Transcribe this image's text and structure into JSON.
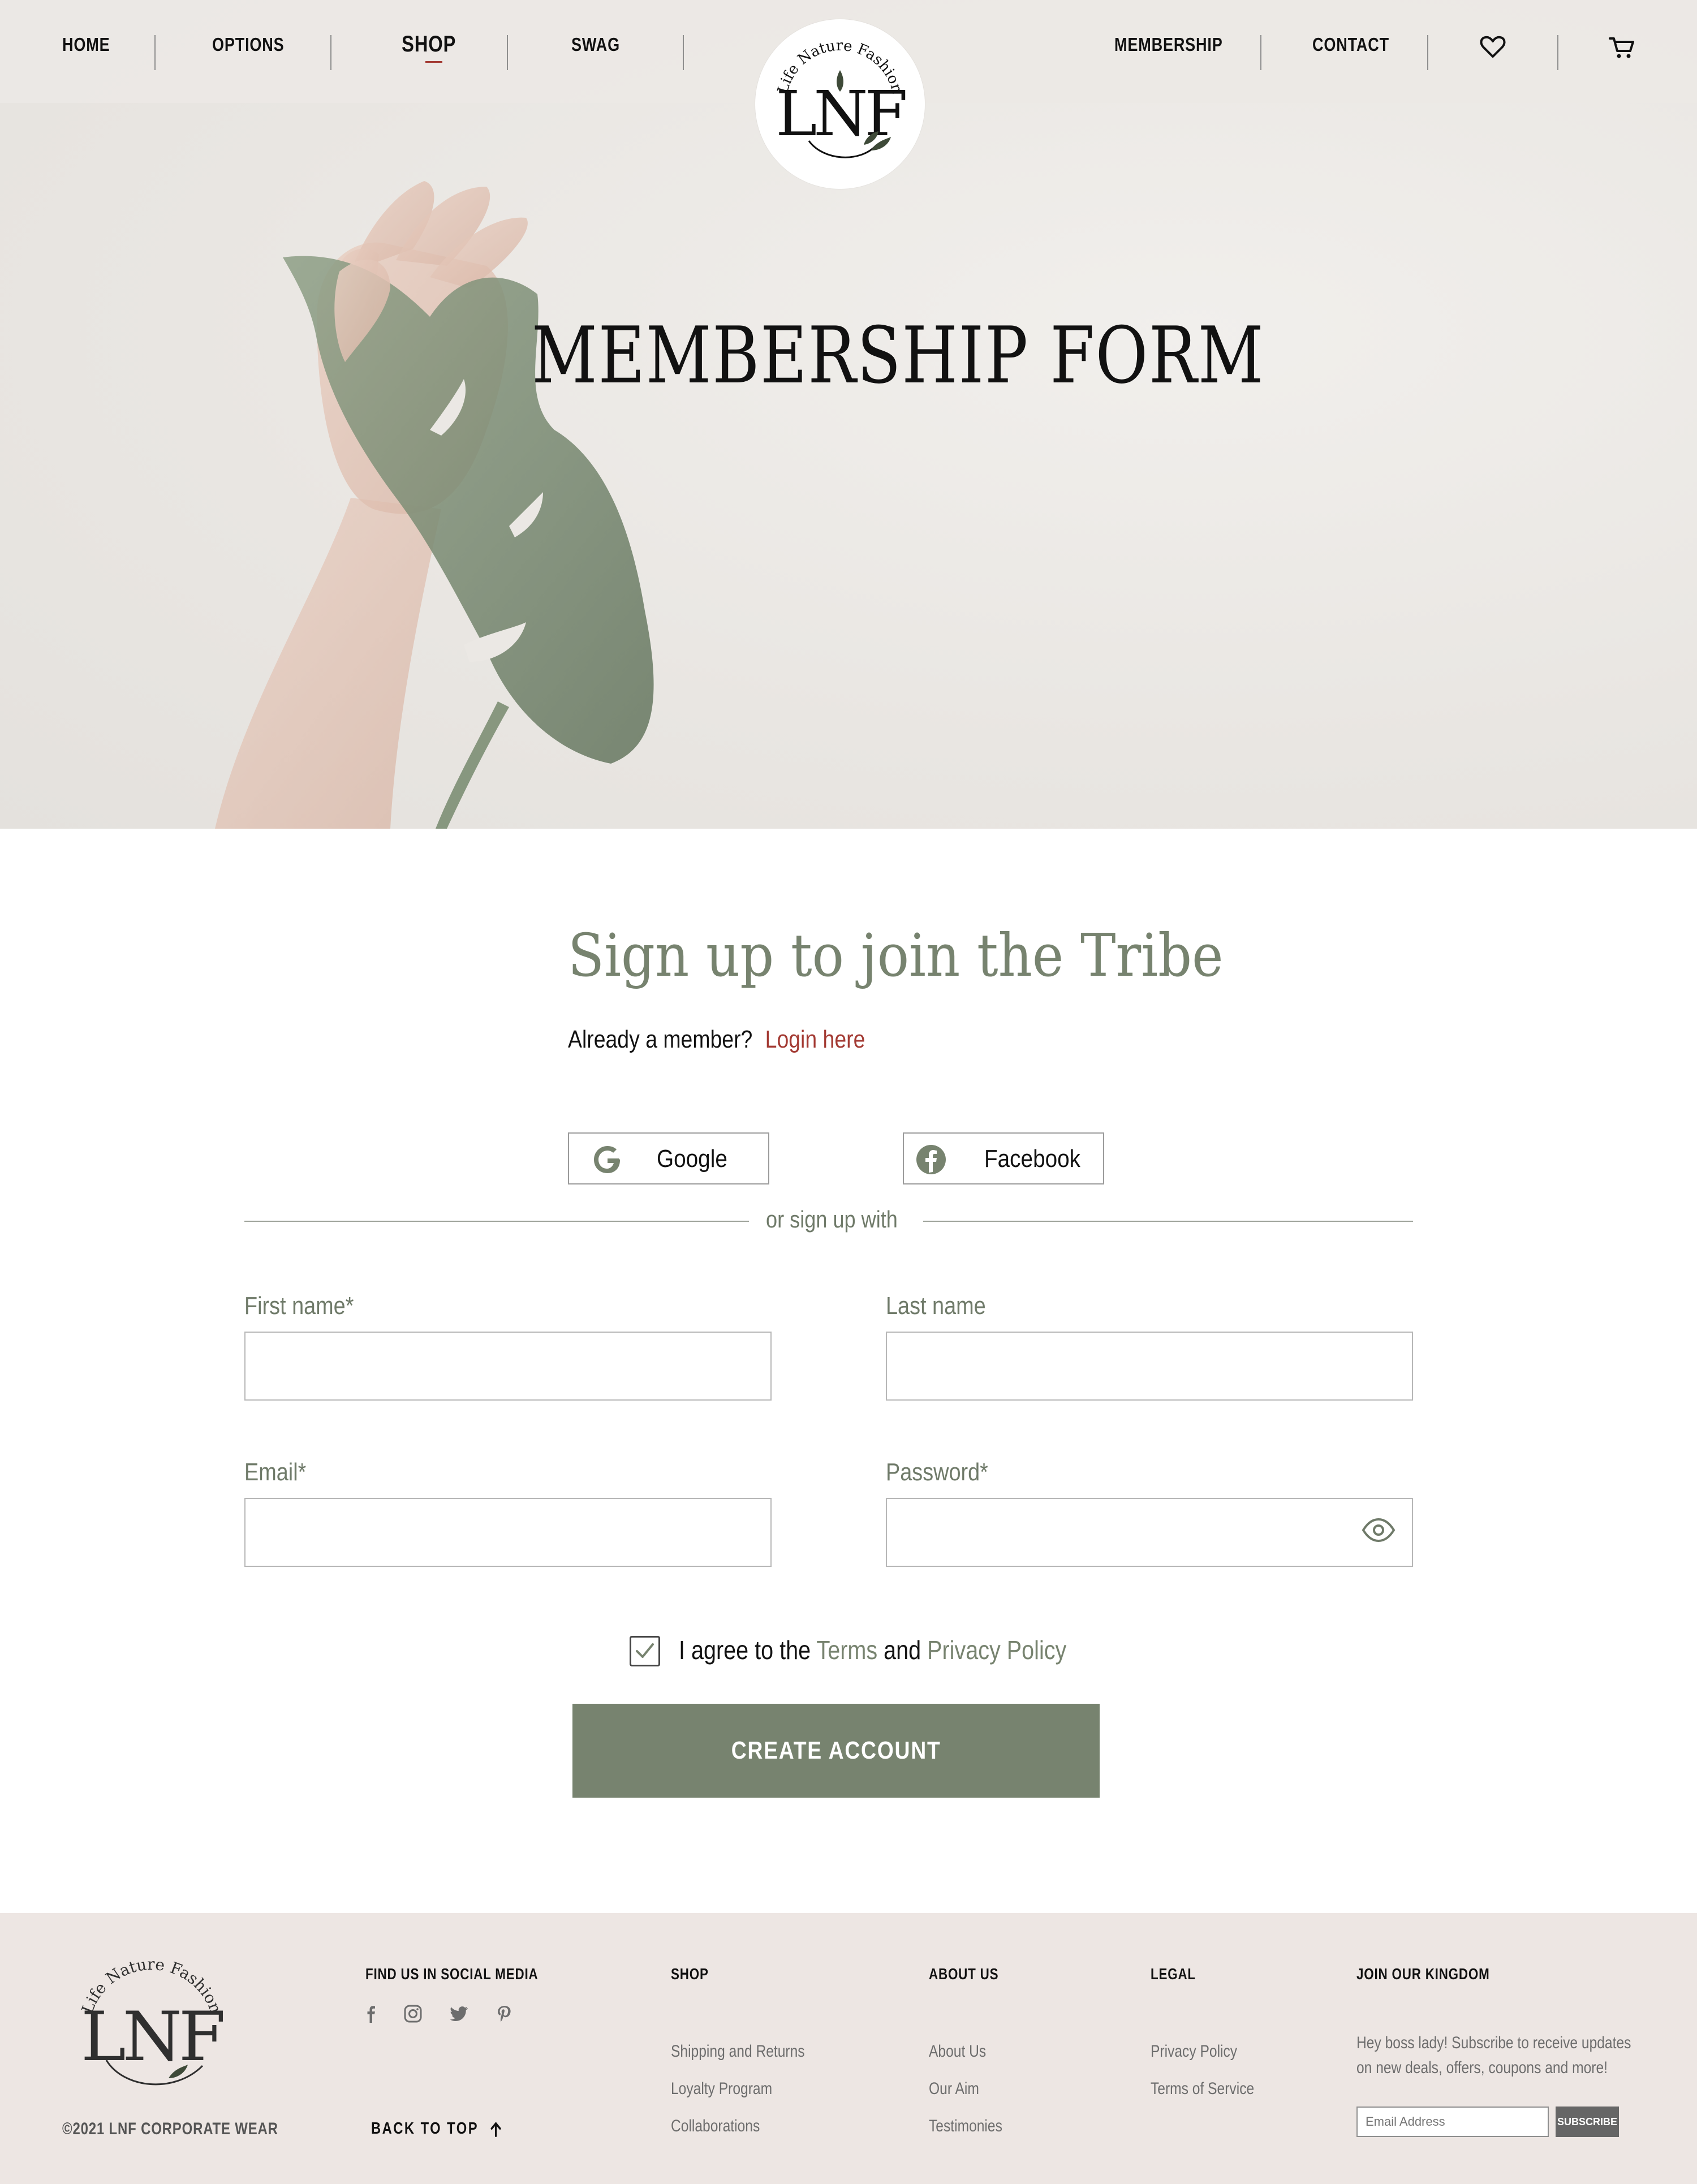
{
  "nav": {
    "left": [
      "HOME",
      "OPTIONS",
      "SHOP",
      "SWAG"
    ],
    "right": [
      "MEMBERSHIP",
      "CONTACT"
    ],
    "active": "SHOP",
    "icons": [
      "heart-icon",
      "cart-icon"
    ]
  },
  "brand": {
    "monogram": "LNF",
    "tagline": "Life Nature Fashion"
  },
  "hero": {
    "title": "MEMBERSHIP FORM"
  },
  "form": {
    "title": "Sign up to join the Tribe",
    "already_text": "Already a member?",
    "login_link": "Login here",
    "google_label": "Google",
    "facebook_label": "Facebook",
    "divider_text": "or sign up with",
    "first_name_label": "First name*",
    "last_name_label": "Last name",
    "email_label": "Email*",
    "password_label": "Password*",
    "first_name_value": "",
    "last_name_value": "",
    "email_value": "",
    "password_value": "",
    "agree_prefix": "I agree to the",
    "terms_link": "Terms",
    "agree_and": "and",
    "privacy_link": "Privacy Policy",
    "agree_checked": true,
    "submit_label": "CREATE ACCOUNT"
  },
  "footer": {
    "copyright": "©2021 LNF CORPORATE WEAR",
    "social_heading": "FIND US IN SOCIAL MEDIA",
    "social_icons": [
      "facebook-icon",
      "instagram-icon",
      "twitter-icon",
      "pinterest-icon"
    ],
    "back_to_top": "BACK TO TOP",
    "shop_heading": "SHOP",
    "shop_links": [
      "Shipping and Returns",
      "Loyalty Program",
      "Collaborations"
    ],
    "about_heading": "ABOUT US",
    "about_links": [
      "About Us",
      "Our Aim",
      "Testimonies"
    ],
    "legal_heading": "LEGAL",
    "legal_links": [
      "Privacy Policy",
      "Terms of Service"
    ],
    "newsletter_heading": "JOIN OUR KINGDOM",
    "newsletter_line1": "Hey boss lady! Subscribe to receive updates",
    "newsletter_line2": "on new deals, offers, coupons and more!",
    "email_placeholder": "Email Address",
    "subscribe_label": "SUBSCRIBE"
  },
  "colors": {
    "accent_green": "#77836f",
    "link_red": "#a33a33",
    "footer_bg": "#ede6e3",
    "nav_bg": "#ece8e5"
  }
}
